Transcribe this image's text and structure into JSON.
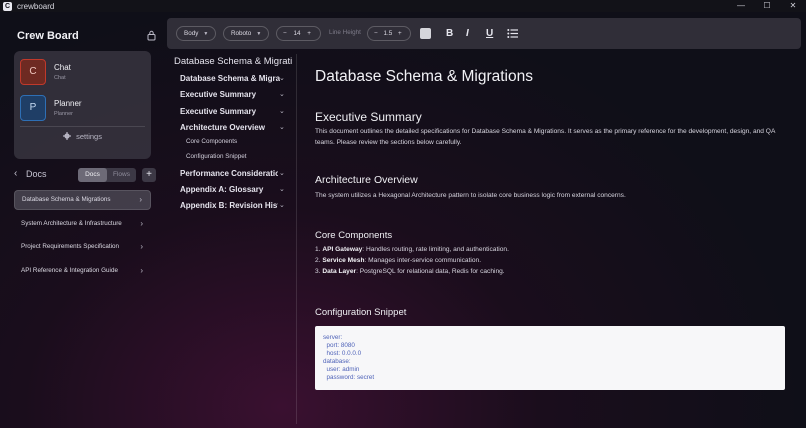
{
  "app": {
    "title": "crewboard",
    "icon_letter": "C"
  },
  "window_controls": {
    "minimize": "—",
    "maximize": "☐",
    "close": "✕"
  },
  "sidebar": {
    "board_title": "Crew Board",
    "agents": [
      {
        "initial": "C",
        "name": "Chat",
        "sub": "Chat",
        "color": "#c0392b"
      },
      {
        "initial": "P",
        "name": "Planner",
        "sub": "Planner",
        "color": "#2e6fb5"
      }
    ],
    "settings_label": "settings",
    "docs_label": "Docs",
    "tabs": [
      "Docs",
      "Flows"
    ],
    "active_tab": "Docs",
    "plus_label": "+",
    "docs": [
      {
        "label": "Database Schema & Migrations",
        "active": true
      },
      {
        "label": "System Architecture & Infrastructure",
        "active": false
      },
      {
        "label": "Project Requirements Specification",
        "active": false
      },
      {
        "label": "API Reference & Integration Guide",
        "active": false
      }
    ]
  },
  "toolbar": {
    "style_select": "Body",
    "font_select": "Roboto",
    "font_size": "14",
    "minus": "−",
    "plus": "+",
    "line_height_label": "Line Height",
    "line_height_value": "1.5",
    "bold": "B",
    "italic": "I",
    "underline": "U"
  },
  "outline": {
    "title": "Database Schema & Migrations",
    "items": [
      {
        "label": "Database Schema & Migrations",
        "level": 1
      },
      {
        "label": "Executive Summary",
        "level": 1
      },
      {
        "label": "Executive Summary",
        "level": 1
      },
      {
        "label": "Architecture Overview",
        "level": 1
      },
      {
        "label": "Core Components",
        "level": 2
      },
      {
        "label": "Configuration Snippet",
        "level": 2
      },
      {
        "label": "Performance Considerations",
        "level": 1
      },
      {
        "label": "Appendix A: Glossary",
        "level": 1
      },
      {
        "label": "Appendix B: Revision History",
        "level": 1
      }
    ]
  },
  "document": {
    "title": "Database Schema & Migrations",
    "executive_summary": {
      "heading": "Executive Summary",
      "body": "This document outlines the detailed specifications for Database Schema & Migrations. It serves as the primary reference for the development, design, and QA teams. Please review the sections below carefully."
    },
    "architecture_overview": {
      "heading": "Architecture Overview",
      "body": "The system utilizes a Hexagonal Architecture pattern to isolate core business logic from external concerns."
    },
    "core_components": {
      "heading": "Core Components",
      "items": [
        {
          "num": "1.",
          "term": "API Gateway",
          "text": ": Handles routing, rate limiting, and authentication."
        },
        {
          "num": "2.",
          "term": "Service Mesh",
          "text": ": Manages inter-service communication."
        },
        {
          "num": "3.",
          "term": "Data Layer",
          "text": ": PostgreSQL for relational data, Redis for caching."
        }
      ]
    },
    "configuration_snippet": {
      "heading": "Configuration Snippet",
      "code": "server:\n  port: 8080\n  host: 0.0.0.0\ndatabase:\n  user: admin\n  password: secret"
    }
  }
}
